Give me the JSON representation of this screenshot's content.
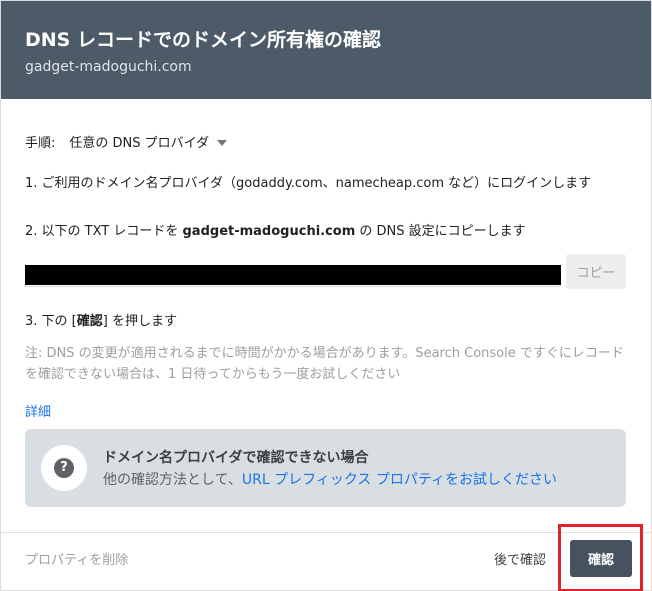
{
  "header": {
    "title": "DNS レコードでのドメイン所有権の確認",
    "subtitle": "gadget-madoguchi.com"
  },
  "procedure": {
    "label": "手順:",
    "selected": "任意の DNS プロバイダ"
  },
  "steps": {
    "step1": "1. ご利用のドメイン名プロバイダ（godaddy.com、namecheap.com など）にログインします",
    "step2_prefix": "2. 以下の TXT レコードを ",
    "step2_domain": "gadget-madoguchi.com",
    "step2_suffix": " の DNS 設定にコピーします",
    "step3_prefix": "3. 下の [",
    "step3_bold": "確認",
    "step3_suffix": "] を押します"
  },
  "txt_record": {
    "copy_label": "コピー"
  },
  "note": "注: DNS の変更が適用されるまでに時間がかかる場合があります。Search Console ですぐにレコードを確認できない場合は、1 日待ってからもう一度お試しください",
  "detail_link": "詳細",
  "info_box": {
    "icon": "help-icon",
    "title": "ドメイン名プロバイダで確認できない場合",
    "text_prefix": "他の確認方法として、",
    "link": "URL プレフィックス プロパティをお試しください"
  },
  "footer": {
    "remove_label": "プロパティを削除",
    "later_label": "後で確認",
    "confirm_label": "確認"
  },
  "colors": {
    "header_bg": "#4c5b67",
    "link": "#1a73e8",
    "confirm_bg": "#46535e",
    "highlight": "#e5202a"
  }
}
